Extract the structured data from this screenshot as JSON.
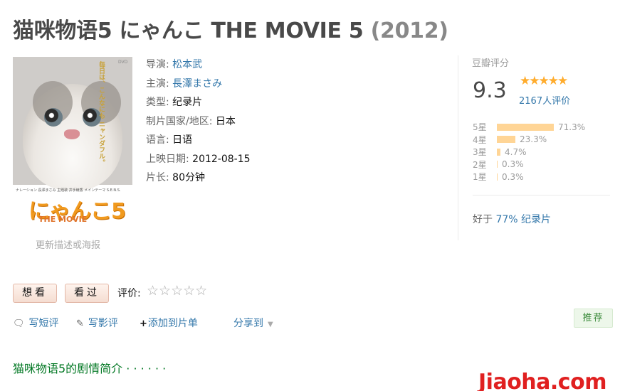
{
  "title": {
    "main": "猫咪物语5 にゃんこ THE MOVIE 5",
    "year": "(2012)"
  },
  "poster": {
    "tagline": "毎日は、こんなにも ニャンダフル。",
    "credits": "ナレーション 長澤まさみ  主題歌 井手綾香  メインテーマ S.E.N.S.",
    "logo": "にゃんこ5",
    "logo_sub": "THE MOVIE",
    "badge": "DVD"
  },
  "update_link": "更新描述或海报",
  "info": [
    {
      "label": "导演:",
      "value": "松本武",
      "link": true
    },
    {
      "label": "主演:",
      "value": "長澤まさみ",
      "link": true
    },
    {
      "label": "类型:",
      "value": "纪录片",
      "link": false
    },
    {
      "label": "制片国家/地区:",
      "value": "日本",
      "link": false
    },
    {
      "label": "语言:",
      "value": "日语",
      "link": false
    },
    {
      "label": "上映日期:",
      "value": "2012-08-15",
      "link": false
    },
    {
      "label": "片长:",
      "value": "80分钟",
      "link": false
    }
  ],
  "rating": {
    "label": "豆瓣评分",
    "score": "9.3",
    "stars_text": "★★★★★",
    "stars_value": 4.5,
    "count": "2167人评价",
    "distribution": [
      {
        "label": "5星",
        "percent": "71.3%",
        "value": 71.3
      },
      {
        "label": "4星",
        "percent": "23.3%",
        "value": 23.3
      },
      {
        "label": "3星",
        "percent": "4.7%",
        "value": 4.7
      },
      {
        "label": "2星",
        "percent": "0.3%",
        "value": 0.3
      },
      {
        "label": "1星",
        "percent": "0.3%",
        "value": 0.3
      }
    ],
    "better_prefix": "好于",
    "better_percent": "77%",
    "better_genre": "纪录片"
  },
  "actions": {
    "want": "想看",
    "seen": "看过",
    "rate_label": "评价:",
    "rate_stars": "☆☆☆☆☆",
    "short_review": "写短评",
    "review": "写影评",
    "add_list": "添加到片单",
    "share": "分享到",
    "recommend": "推荐"
  },
  "synopsis": "猫咪物语5的剧情简介 · · · · · ·",
  "watermark": "Jiaoha.com",
  "colors": {
    "link": "#3377aa",
    "star": "#ffac2d",
    "bar": "#ffd596",
    "green": "#007722"
  }
}
